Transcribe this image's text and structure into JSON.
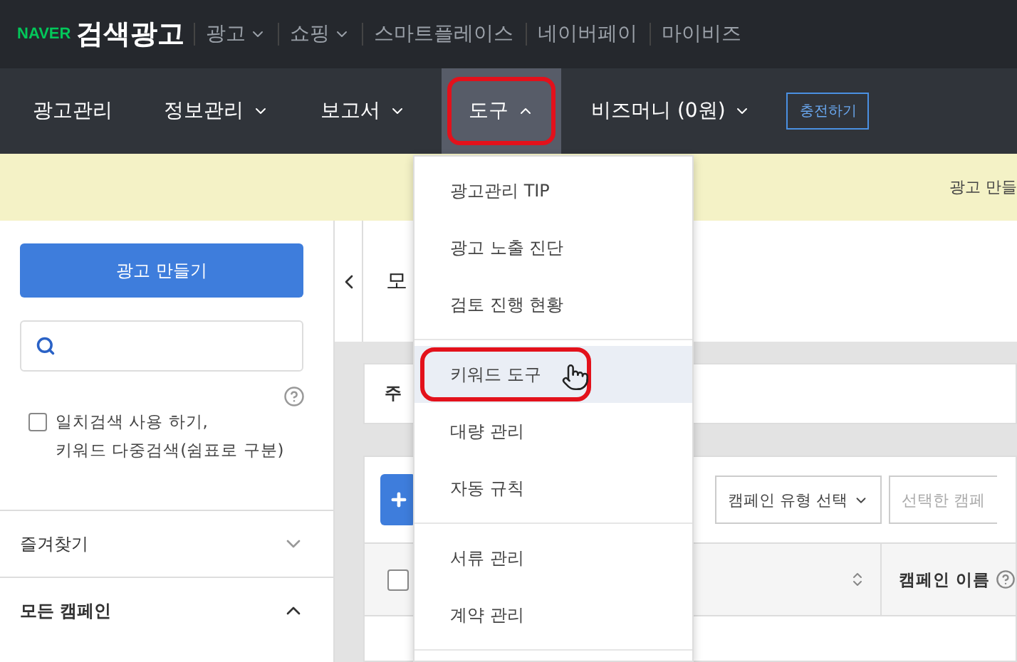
{
  "header": {
    "brand": "NAVER",
    "product": "검색광고",
    "links": [
      {
        "label": "광고",
        "has_menu": true
      },
      {
        "label": "쇼핑",
        "has_menu": true
      },
      {
        "label": "스마트플레이스",
        "has_menu": false
      },
      {
        "label": "네이버페이",
        "has_menu": false
      },
      {
        "label": "마이비즈",
        "has_menu": false
      }
    ]
  },
  "nav": {
    "items": [
      {
        "label": "광고관리",
        "has_menu": false,
        "selected": false,
        "annotated": false
      },
      {
        "label": "정보관리",
        "has_menu": true,
        "selected": false,
        "annotated": false
      },
      {
        "label": "보고서",
        "has_menu": true,
        "selected": false,
        "annotated": false
      },
      {
        "label": "도구",
        "has_menu": true,
        "selected": true,
        "annotated": true
      },
      {
        "label": "비즈머니 (0원)",
        "has_menu": true,
        "selected": false,
        "annotated": false
      }
    ],
    "charge_button": "충전하기"
  },
  "banner": {
    "text": "광고 만들"
  },
  "sidebar": {
    "create_button": "광고 만들기",
    "exact_search": {
      "checked": false,
      "label": "일치검색 사용 하기,\n키워드 다중검색(쉼표로 구분)"
    },
    "sections": [
      {
        "label": "즐겨찾기",
        "expanded": false
      },
      {
        "label": "모든 캠페인",
        "expanded": true
      }
    ]
  },
  "main": {
    "title": "모",
    "summary": "주",
    "filter": "캠페인 유형 선택",
    "action": "선택한 캠페",
    "table": {
      "select_all_checked": false,
      "columns": [
        {
          "label": "캠페인 이름"
        }
      ]
    }
  },
  "menu": {
    "groups": [
      [
        {
          "label": "광고관리 TIP",
          "hovered": false,
          "annotated": false
        },
        {
          "label": "광고 노출 진단",
          "hovered": false,
          "annotated": false
        },
        {
          "label": "검토 진행 현황",
          "hovered": false,
          "annotated": false
        }
      ],
      [
        {
          "label": "키워드 도구",
          "hovered": true,
          "annotated": true
        },
        {
          "label": "대량 관리",
          "hovered": false,
          "annotated": false
        },
        {
          "label": "자동 규칙",
          "hovered": false,
          "annotated": false
        }
      ],
      [
        {
          "label": "서류 관리",
          "hovered": false,
          "annotated": false
        },
        {
          "label": "계약 관리",
          "hovered": false,
          "annotated": false
        }
      ]
    ]
  }
}
